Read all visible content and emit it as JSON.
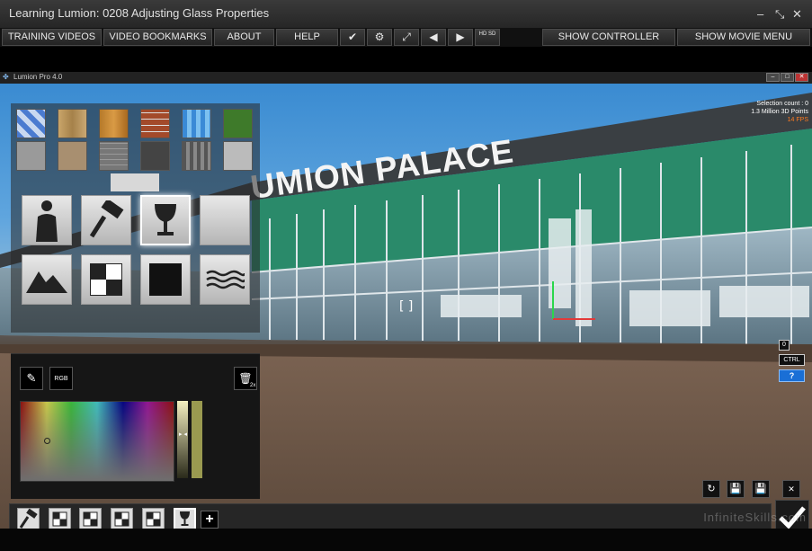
{
  "window": {
    "title": "Learning Lumion: 0208 Adjusting Glass Properties",
    "minimize": "–",
    "close": "✕"
  },
  "menu": {
    "training_videos": "TRAINING VIDEOS",
    "video_bookmarks": "VIDEO BOOKMARKS",
    "about": "ABOUT",
    "help": "HELP",
    "check_icon": "✔",
    "gear_icon": "⚙",
    "expand_icon": "⤢",
    "prev_icon": "◀",
    "next_icon": "▶",
    "hdsd": "HD SD",
    "show_controller": "SHOW CONTROLLER",
    "show_movie_menu": "SHOW MOVIE MENU"
  },
  "lumion": {
    "title": "Lumion Pro 4.0",
    "stats": {
      "selection": "Selection count : 0",
      "points": "1.3 Million 3D Points",
      "fps": "14 FPS"
    },
    "sign_text": "UMION PALACE",
    "ctrl_label": "CTRL",
    "help_label": "?",
    "zero_label": "0",
    "rgb_label": "RGB",
    "trash_count": "2x"
  },
  "colors": {
    "accent_orange": "#ff7a20",
    "help_blue": "#1a6fd6",
    "glass_green": "#2a8a6a"
  },
  "watermark": "InfiniteSkills.com"
}
